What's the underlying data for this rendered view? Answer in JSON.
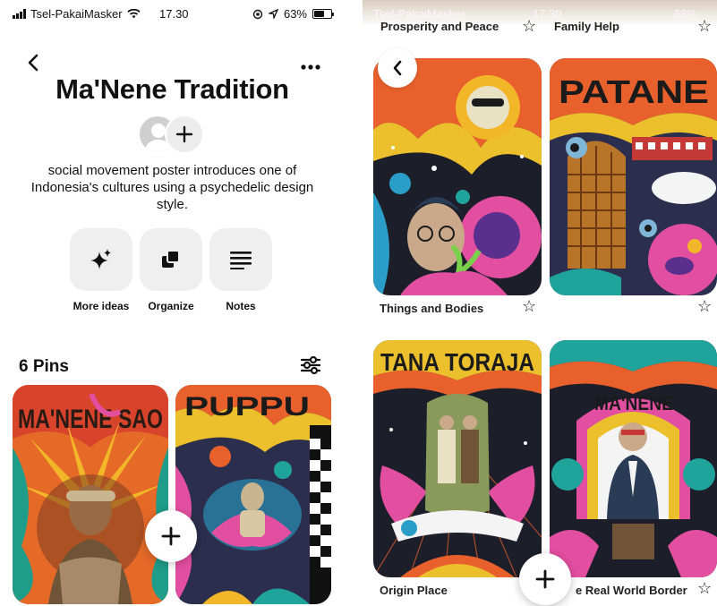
{
  "status_bar": {
    "carrier": "Tsel-PakaiMasker",
    "time": "17.30",
    "battery": "63%",
    "battery_level": 0.63
  },
  "board": {
    "title": "Ma'Nene Tradition",
    "description": "social movement poster introduces one of Indonesia's cultures using a psychedelic design style.",
    "actions": [
      {
        "label": "More ideas",
        "icon": "sparkle-icon"
      },
      {
        "label": "Organize",
        "icon": "organize-icon"
      },
      {
        "label": "Notes",
        "icon": "notes-icon"
      }
    ],
    "pins_count": "6 Pins"
  },
  "related": {
    "top_labels": [
      "Prosperity and Peace",
      "Family Help"
    ],
    "pins": [
      {
        "label": "Things and Bodies",
        "art": "TANA TORAJA"
      },
      {
        "label": "",
        "art": "PATANE"
      },
      {
        "label": "Origin Place",
        "art": "TANA TORAJA"
      },
      {
        "label": "e Real World Border",
        "art": "MA'NENE"
      }
    ]
  },
  "left_pins": [
    {
      "art": "MA'NENE SAO"
    },
    {
      "art": "PUPPU"
    }
  ],
  "colors": {
    "accent_orange": "#e8612c",
    "accent_pink": "#e24fa0",
    "accent_teal": "#1fa39a",
    "dark_bg": "#1c1e2a",
    "tile_bg": "#efefef"
  }
}
